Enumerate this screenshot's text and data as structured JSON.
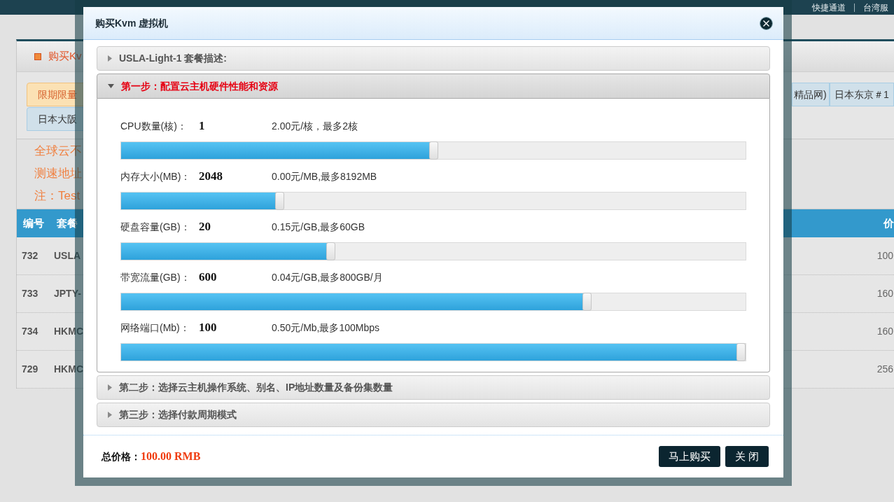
{
  "page": {
    "top_links": [
      "快捷通道",
      "台湾服"
    ],
    "panel_title": "购买Kv",
    "tab_rows": [
      [
        {
          "label": "限期限量",
          "selected": true
        },
        {
          "label": "精品网)",
          "selected": false
        },
        {
          "label": "日本东京＃1",
          "selected": false
        }
      ],
      [
        {
          "label": "日本大阪",
          "selected": false
        }
      ]
    ],
    "notices": [
      "全球云不",
      "测速地址",
      "注：Test"
    ],
    "table": {
      "columns": [
        "编号",
        "套餐",
        "价"
      ],
      "rows": [
        {
          "id": "732",
          "name": "USLA",
          "price": "100"
        },
        {
          "id": "733",
          "name": "JPTY-",
          "price": "160"
        },
        {
          "id": "734",
          "name": "HKMC",
          "price": "160"
        },
        {
          "id": "729",
          "name": "HKMC",
          "price": "256"
        }
      ]
    }
  },
  "dialog": {
    "title": "购买Kvm 虚拟机",
    "sections": [
      {
        "title": "USLA-Light-1 套餐描述:",
        "expanded": false
      },
      {
        "title": "第一步：配置云主机硬件性能和资源",
        "expanded": true,
        "sliders": [
          {
            "label": "CPU数量(核)：",
            "value": "1",
            "note": "2.00元/核，最多2核",
            "level": 0.5
          },
          {
            "label": "内存大小(MB)：",
            "value": "2048",
            "note": "0.00元/MB,最多8192MB",
            "level": 0.25
          },
          {
            "label": "硬盘容量(GB)：",
            "value": "20",
            "note": "0.15元/GB,最多60GB",
            "level": 0.333
          },
          {
            "label": "带宽流量(GB)：",
            "value": "600",
            "note": "0.04元/GB,最多800GB/月",
            "level": 0.75
          },
          {
            "label": "网络端口(Mb)：",
            "value": "100",
            "note": "0.50元/Mb,最多100Mbps",
            "level": 1
          }
        ]
      },
      {
        "title": "第二步：选择云主机操作系统、别名、IP地址数量及备份集数量",
        "expanded": false
      },
      {
        "title": "第三步：选择付款周期模式",
        "expanded": false
      }
    ],
    "total_label": "总价格：",
    "total": "100.00 RMB",
    "buttons": [
      "马上购买",
      "关 闭"
    ]
  }
}
